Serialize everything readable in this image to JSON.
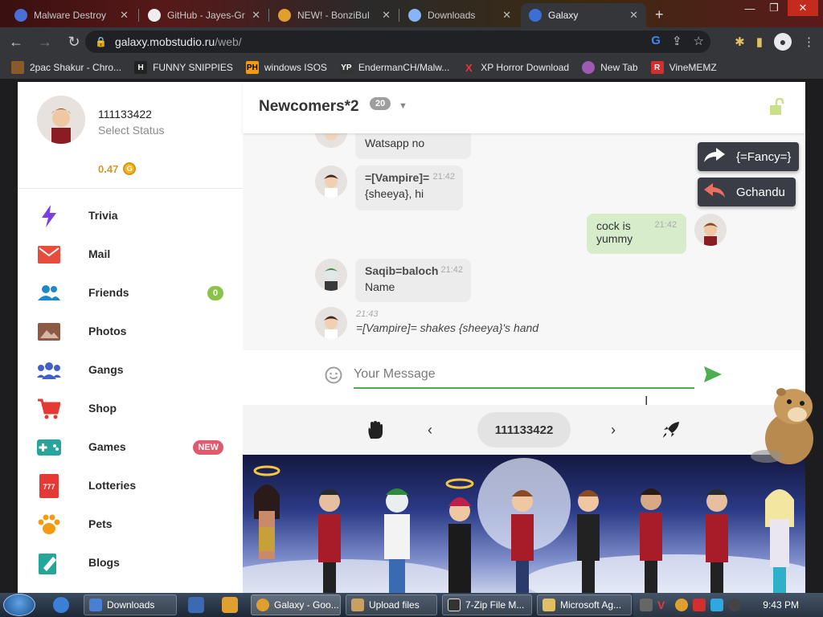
{
  "browser": {
    "tabs": [
      {
        "label": "Malware Destroy",
        "active": false
      },
      {
        "label": "GitHub - Jayes-Gr",
        "active": false
      },
      {
        "label": "NEW! - BonziBuI",
        "active": false
      },
      {
        "label": "Downloads",
        "active": false
      },
      {
        "label": "Galaxy",
        "active": true
      }
    ],
    "url_host": "galaxy.mobstudio.ru",
    "url_path": "/web/",
    "bookmarks": [
      {
        "label": "2pac Shakur - Chro...",
        "icon": "2pac-icon",
        "color": "#8a5a2a"
      },
      {
        "label": "FUNNY SNIPPIES",
        "icon": "H",
        "color": "#222222"
      },
      {
        "label": "windows ISOS",
        "icon": "PH",
        "color": "#f39c12"
      },
      {
        "label": "EndermanCH/Malw...",
        "icon": "YP",
        "color": "#333333"
      },
      {
        "label": "XP Horror Download",
        "icon": "X",
        "color": "#e53935"
      },
      {
        "label": "New Tab",
        "icon": "globe-icon",
        "color": "#9c5ab0"
      },
      {
        "label": "VineMEMZ",
        "icon": "R",
        "color": "#d32f2f"
      }
    ]
  },
  "profile": {
    "username": "111133422",
    "status": "Select Status",
    "balance": "0.47",
    "coin_symbol": "G"
  },
  "menu": [
    {
      "label": "Trivia",
      "icon": "lightning-icon",
      "color": "#7b3fe4",
      "badge": ""
    },
    {
      "label": "Mail",
      "icon": "mail-icon",
      "color": "#e74c3c",
      "badge": ""
    },
    {
      "label": "Friends",
      "icon": "friends-icon",
      "color": "#1e88c8",
      "badge": "0"
    },
    {
      "label": "Photos",
      "icon": "photos-icon",
      "color": "#8d5a45",
      "badge": ""
    },
    {
      "label": "Gangs",
      "icon": "gangs-icon",
      "color": "#3f5fc9",
      "badge": ""
    },
    {
      "label": "Shop",
      "icon": "cart-icon",
      "color": "#e53935",
      "badge": ""
    },
    {
      "label": "Games",
      "icon": "gamepad-icon",
      "color": "#26a69a",
      "badge": "NEW"
    },
    {
      "label": "Lotteries",
      "icon": "ticket-icon",
      "color": "#e53935",
      "badge": ""
    },
    {
      "label": "Pets",
      "icon": "paw-icon",
      "color": "#f39c12",
      "badge": ""
    },
    {
      "label": "Blogs",
      "icon": "blog-icon",
      "color": "#26a69a",
      "badge": ""
    }
  ],
  "chat": {
    "room": "Newcomers*2",
    "room_count": "20",
    "messages": [
      {
        "author": "",
        "text": "Watsapp no",
        "time": "",
        "mine": false
      },
      {
        "author": "=[Vampire]=",
        "text": "{sheeya}, hi",
        "time": "21:42",
        "mine": false
      },
      {
        "author": "",
        "text": "cock is yummy",
        "time": "21:42",
        "mine": true
      },
      {
        "author": "Saqib=baloch",
        "text": "Name",
        "time": "21:42",
        "mine": false
      },
      {
        "author": "",
        "text": "=[Vampire]= shakes {sheeya}'s hand",
        "time": "21:43",
        "mine": false,
        "emote": true
      }
    ],
    "actions": [
      {
        "label": "{=Fancy=}",
        "icon": "share-arrow-icon"
      },
      {
        "label": "Gchandu",
        "icon": "reply-arrow-icon"
      }
    ],
    "composer_placeholder": "Your Message",
    "pager_number": "111133422"
  },
  "taskbar": {
    "items": [
      {
        "label": "Downloads",
        "color": "#4a7fd6"
      },
      {
        "label": "Galaxy - Goo...",
        "color": "#e0a030"
      },
      {
        "label": "Upload files",
        "color": "#c8a060"
      },
      {
        "label": "7-Zip File M...",
        "color": "#333333"
      },
      {
        "label": "Microsoft Ag...",
        "color": "#e0c060"
      }
    ],
    "clock": "9:43 PM"
  }
}
